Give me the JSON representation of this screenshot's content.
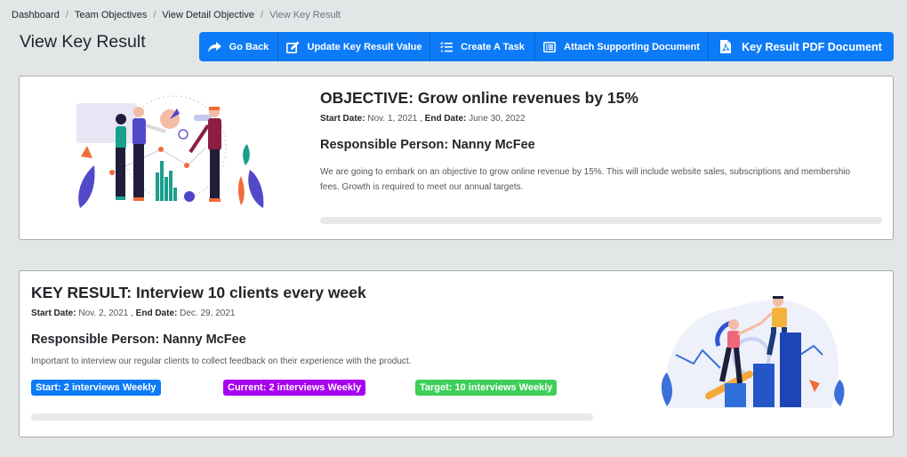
{
  "breadcrumb": {
    "items": [
      "Dashboard",
      "Team Objectives",
      "View Detail Objective"
    ],
    "current": "View Key Result",
    "separator": "/"
  },
  "page": {
    "title": "View Key Result"
  },
  "toolbar": {
    "color": "#0d7bf7",
    "buttons": [
      {
        "label": "Go Back",
        "icon": "share-arrow-icon"
      },
      {
        "label": "Update Key Result Value",
        "icon": "edit-icon"
      },
      {
        "label": "Create A Task",
        "icon": "tasks-icon"
      },
      {
        "label": "Attach Supporting Document",
        "icon": "list-alt-icon"
      },
      {
        "label": "Key Result PDF Document",
        "icon": "file-pdf-icon"
      }
    ]
  },
  "objective": {
    "title": "OBJECTIVE: Grow online revenues by 15%",
    "start_label": "Start Date:",
    "start_date": "Nov. 1, 2021",
    "end_label": "End Date:",
    "end_date": "June 30, 2022",
    "responsible": "Responsible Person: Nanny McFee",
    "description": "We are going to embark on an objective to grow online revenue by 15%. This will include website sales, subscriptions and membershio fees. Growth is required to meet our annual targets.",
    "progress_percent": 0,
    "illustration": "team-analytics-illustration"
  },
  "key_result": {
    "title": "KEY RESULT: Interview 10 clients every week",
    "start_label": "Start Date:",
    "start_date": "Nov. 2, 2021",
    "end_label": "End Date:",
    "end_date": "Dec. 29, 2021",
    "responsible": "Responsible Person: Nanny McFee",
    "description": "Important to interview our regular clients to collect feedback on their experience with the product.",
    "badges": {
      "start": {
        "label": "Start: 2 interviews Weekly",
        "color": "#0d7bf7"
      },
      "current": {
        "label": "Current: 2 interviews Weekly",
        "color": "#a800f0"
      },
      "target": {
        "label": "Target: 10 interviews Weekly",
        "color": "#3ecf5a"
      }
    },
    "progress_percent": 0,
    "illustration": "teamwork-growth-illustration"
  }
}
